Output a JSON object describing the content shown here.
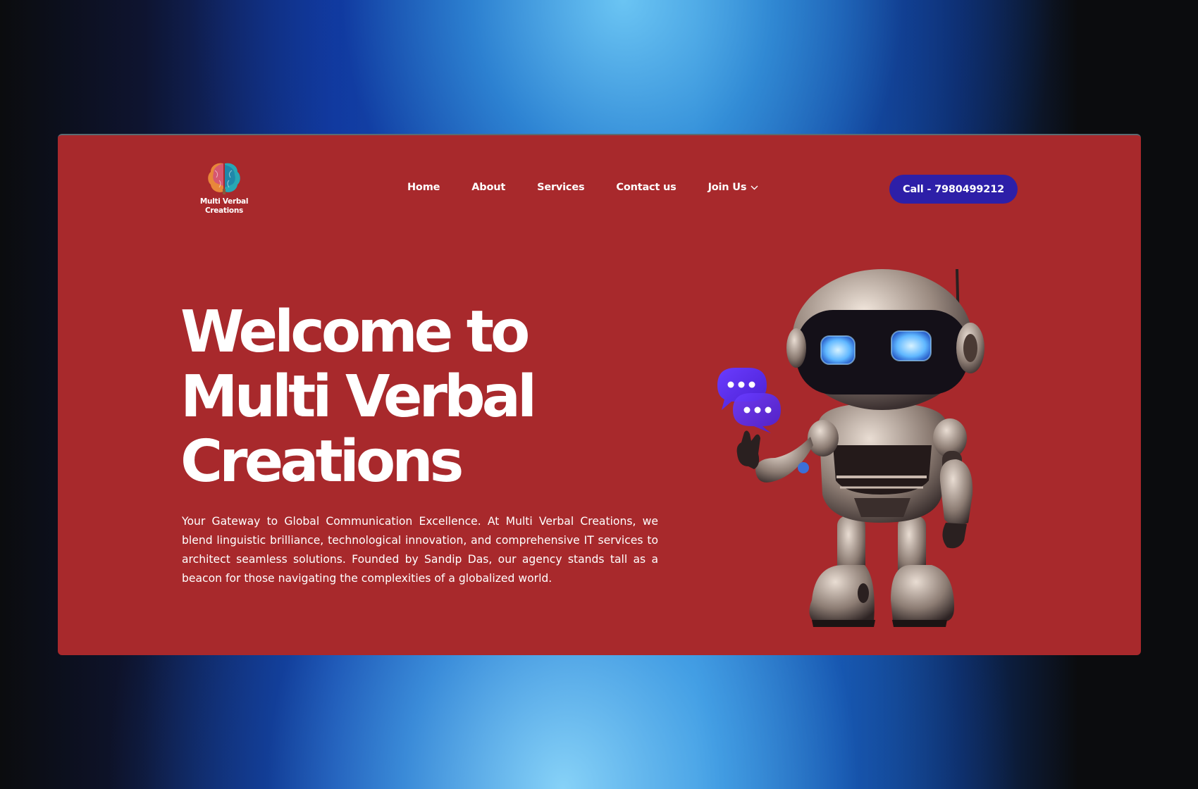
{
  "brand": {
    "name": "Multi Verbal\nCreations"
  },
  "nav": {
    "items": [
      {
        "label": "Home"
      },
      {
        "label": "About"
      },
      {
        "label": "Services"
      },
      {
        "label": "Contact us"
      },
      {
        "label": "Join Us"
      }
    ]
  },
  "cta": {
    "label": "Call - 7980499212"
  },
  "hero": {
    "title_lines": [
      "Welcome to",
      "Multi Verbal",
      "Creations"
    ],
    "description": "Your Gateway to Global Communication Excellence. At Multi Verbal Creations, we blend linguistic brilliance, technological innovation, and comprehensive IT services to architect seamless solutions. Founded by Sandip Das, our agency stands tall as a beacon for those navigating the complexities of a globalized world."
  },
  "icons": {
    "logo": "brain-icon",
    "dropdown": "chevron-down-icon",
    "chat": "chat-bubble-icon"
  },
  "colors": {
    "card_bg": "#a8292c",
    "cta_bg": "#2d1fa8",
    "chat_bubble": "#5b2ff0"
  }
}
